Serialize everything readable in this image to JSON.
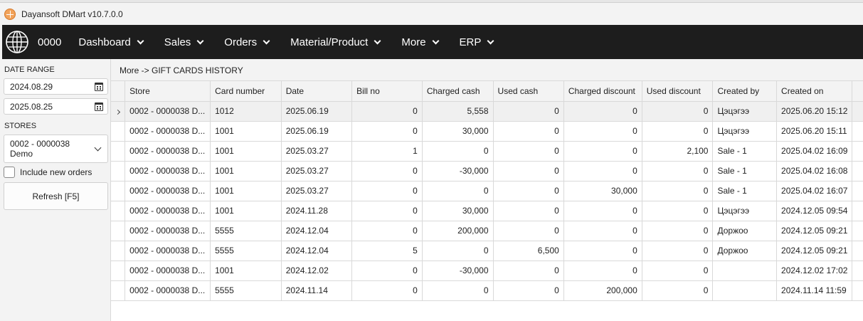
{
  "window": {
    "title": "Dayansoft DMart v10.7.0.0"
  },
  "nav": {
    "code": "0000",
    "items": [
      {
        "label": "Dashboard"
      },
      {
        "label": "Sales"
      },
      {
        "label": "Orders"
      },
      {
        "label": "Material/Product"
      },
      {
        "label": "More"
      },
      {
        "label": "ERP"
      }
    ]
  },
  "filters": {
    "date_range_label": "DATE RANGE",
    "date_from": "2024.08.29",
    "date_to": "2025.08.25",
    "stores_label": "STORES",
    "store_line1": "0002 - 0000038",
    "store_line2": "Demo",
    "include_new_orders_label": "Include new orders",
    "include_new_orders_checked": false,
    "refresh_label": "Refresh [F5]"
  },
  "breadcrumb": "More -> GIFT CARDS HISTORY",
  "table": {
    "columns": [
      "Store",
      "Card number",
      "Date",
      "Bill no",
      "Charged cash",
      "Used cash",
      "Charged discount",
      "Used discount",
      "Created by",
      "Created on"
    ],
    "rows": [
      [
        "0002 - 0000038 D...",
        "1012",
        "2025.06.19",
        "0",
        "5,558",
        "0",
        "0",
        "0",
        "Цэцэгээ",
        "2025.06.20 15:12"
      ],
      [
        "0002 - 0000038 D...",
        "1001",
        "2025.06.19",
        "0",
        "30,000",
        "0",
        "0",
        "0",
        "Цэцэгээ",
        "2025.06.20 15:11"
      ],
      [
        "0002 - 0000038 D...",
        "1001",
        "2025.03.27",
        "1",
        "0",
        "0",
        "0",
        "2,100",
        "Sale - 1",
        "2025.04.02 16:09"
      ],
      [
        "0002 - 0000038 D...",
        "1001",
        "2025.03.27",
        "0",
        "-30,000",
        "0",
        "0",
        "0",
        "Sale - 1",
        "2025.04.02 16:08"
      ],
      [
        "0002 - 0000038 D...",
        "1001",
        "2025.03.27",
        "0",
        "0",
        "0",
        "30,000",
        "0",
        "Sale - 1",
        "2025.04.02 16:07"
      ],
      [
        "0002 - 0000038 D...",
        "1001",
        "2024.11.28",
        "0",
        "30,000",
        "0",
        "0",
        "0",
        "Цэцэгээ",
        "2024.12.05 09:54"
      ],
      [
        "0002 - 0000038 D...",
        "5555",
        "2024.12.04",
        "0",
        "200,000",
        "0",
        "0",
        "0",
        "Доржоо",
        "2024.12.05 09:21"
      ],
      [
        "0002 - 0000038 D...",
        "5555",
        "2024.12.04",
        "5",
        "0",
        "6,500",
        "0",
        "0",
        "Доржоо",
        "2024.12.05 09:21"
      ],
      [
        "0002 - 0000038 D...",
        "1001",
        "2024.12.02",
        "0",
        "-30,000",
        "0",
        "0",
        "0",
        "",
        "2024.12.02 17:02"
      ],
      [
        "0002 - 0000038 D...",
        "5555",
        "2024.11.14",
        "0",
        "0",
        "0",
        "200,000",
        "0",
        "",
        "2024.11.14 11:59"
      ]
    ],
    "selected_row": 0
  }
}
